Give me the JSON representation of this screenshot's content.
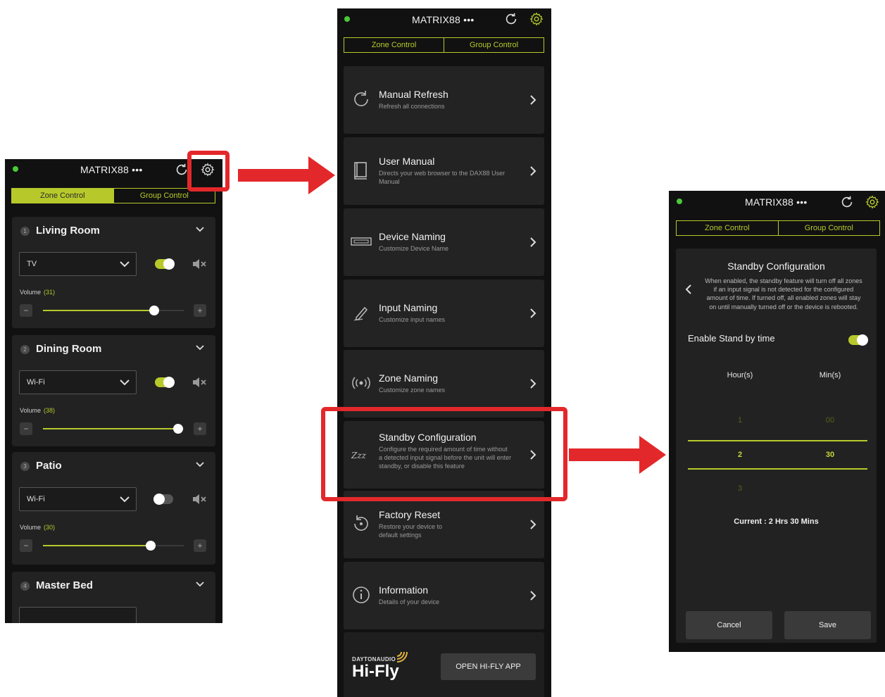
{
  "app": {
    "title": "MATRIX88 •••",
    "tabs": [
      "Zone Control",
      "Group Control"
    ],
    "accent_color": "#b7c92a",
    "status_color": "#4cc93a"
  },
  "zone_control": {
    "active_tab": "Zone Control",
    "zones": [
      {
        "num": "1",
        "name": "Living Room",
        "source": "TV",
        "enabled": true,
        "volume_label": "Volume",
        "volume_text": "(31)",
        "volume": 31
      },
      {
        "num": "2",
        "name": "Dining Room",
        "source": "Wi-Fi",
        "enabled": true,
        "volume_label": "Volume",
        "volume_text": "(38)",
        "volume": 38
      },
      {
        "num": "3",
        "name": "Patio",
        "source": "Wi-Fi",
        "enabled": false,
        "volume_label": "Volume",
        "volume_text": "(30)",
        "volume": 30
      },
      {
        "num": "4",
        "name": "Master Bed"
      }
    ]
  },
  "settings_menu": {
    "items": [
      {
        "title": "Manual Refresh",
        "subtitle": "Refresh all connections",
        "icon": "refresh-icon"
      },
      {
        "title": "User Manual",
        "subtitle": "Directs your web browser to the DAX88 User Manual",
        "icon": "book-icon"
      },
      {
        "title": "Device Naming",
        "subtitle": "Customize Device Name",
        "icon": "device-icon"
      },
      {
        "title": "Input Naming",
        "subtitle": "Customize input names",
        "icon": "pen-icon"
      },
      {
        "title": "Zone Naming",
        "subtitle": "Customize zone names",
        "icon": "broadcast-icon"
      },
      {
        "title": "Standby Configuration",
        "subtitle": "Configure the required amount of time without a detected input signal before the unit will enter standby, or disable this feature",
        "icon": "sleep-icon"
      },
      {
        "title": "Factory Reset",
        "subtitle": "Restore your device to default settings",
        "icon": "reset-icon"
      },
      {
        "title": "Information",
        "subtitle": "Details of your device",
        "icon": "info-icon"
      }
    ],
    "brand_small": "DAYTONAUDIO",
    "brand_big": "Hi-Fly",
    "open_button": "OPEN HI-FLY APP"
  },
  "standby": {
    "title": "Standby Configuration",
    "description": "When enabled, the standby feature will turn off all zones if an input signal is not detected for the configured amount of time. If turned off, all enabled zones will stay on until manually turned off or the device is rebooted.",
    "enable_label": "Enable Stand by time",
    "enabled": true,
    "hours_label": "Hour(s)",
    "mins_label": "Min(s)",
    "hours_above": "1",
    "hours_selected": "2",
    "hours_below": "3",
    "mins_above": "00",
    "mins_selected": "30",
    "current_text": "Current : 2 Hrs 30 Mins",
    "cancel_label": "Cancel",
    "save_label": "Save"
  },
  "annotation_color": "#e3282b"
}
